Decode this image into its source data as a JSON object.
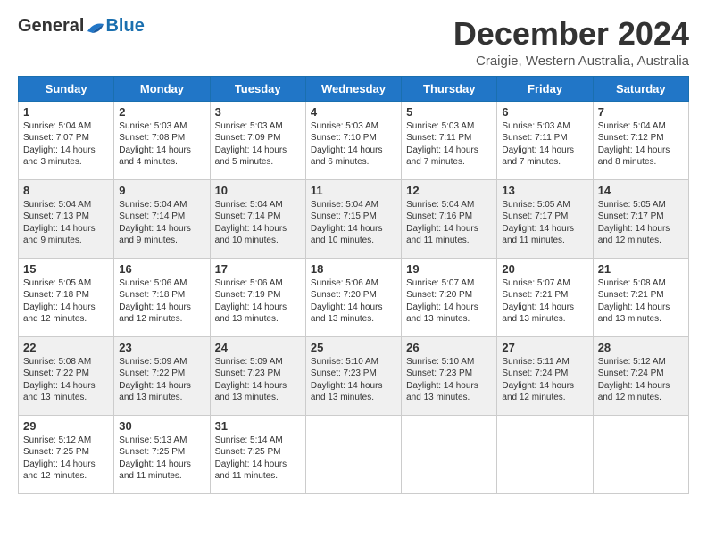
{
  "header": {
    "logo": {
      "general": "General",
      "blue": "Blue"
    },
    "title": "December 2024",
    "subtitle": "Craigie, Western Australia, Australia"
  },
  "calendar": {
    "days_of_week": [
      "Sunday",
      "Monday",
      "Tuesday",
      "Wednesday",
      "Thursday",
      "Friday",
      "Saturday"
    ],
    "weeks": [
      [
        {
          "day": "1",
          "sunrise": "5:04 AM",
          "sunset": "7:07 PM",
          "daylight": "14 hours and 3 minutes."
        },
        {
          "day": "2",
          "sunrise": "5:03 AM",
          "sunset": "7:08 PM",
          "daylight": "14 hours and 4 minutes."
        },
        {
          "day": "3",
          "sunrise": "5:03 AM",
          "sunset": "7:09 PM",
          "daylight": "14 hours and 5 minutes."
        },
        {
          "day": "4",
          "sunrise": "5:03 AM",
          "sunset": "7:10 PM",
          "daylight": "14 hours and 6 minutes."
        },
        {
          "day": "5",
          "sunrise": "5:03 AM",
          "sunset": "7:11 PM",
          "daylight": "14 hours and 7 minutes."
        },
        {
          "day": "6",
          "sunrise": "5:03 AM",
          "sunset": "7:11 PM",
          "daylight": "14 hours and 7 minutes."
        },
        {
          "day": "7",
          "sunrise": "5:04 AM",
          "sunset": "7:12 PM",
          "daylight": "14 hours and 8 minutes."
        }
      ],
      [
        {
          "day": "8",
          "sunrise": "5:04 AM",
          "sunset": "7:13 PM",
          "daylight": "14 hours and 9 minutes."
        },
        {
          "day": "9",
          "sunrise": "5:04 AM",
          "sunset": "7:14 PM",
          "daylight": "14 hours and 9 minutes."
        },
        {
          "day": "10",
          "sunrise": "5:04 AM",
          "sunset": "7:14 PM",
          "daylight": "14 hours and 10 minutes."
        },
        {
          "day": "11",
          "sunrise": "5:04 AM",
          "sunset": "7:15 PM",
          "daylight": "14 hours and 10 minutes."
        },
        {
          "day": "12",
          "sunrise": "5:04 AM",
          "sunset": "7:16 PM",
          "daylight": "14 hours and 11 minutes."
        },
        {
          "day": "13",
          "sunrise": "5:05 AM",
          "sunset": "7:17 PM",
          "daylight": "14 hours and 11 minutes."
        },
        {
          "day": "14",
          "sunrise": "5:05 AM",
          "sunset": "7:17 PM",
          "daylight": "14 hours and 12 minutes."
        }
      ],
      [
        {
          "day": "15",
          "sunrise": "5:05 AM",
          "sunset": "7:18 PM",
          "daylight": "14 hours and 12 minutes."
        },
        {
          "day": "16",
          "sunrise": "5:06 AM",
          "sunset": "7:18 PM",
          "daylight": "14 hours and 12 minutes."
        },
        {
          "day": "17",
          "sunrise": "5:06 AM",
          "sunset": "7:19 PM",
          "daylight": "14 hours and 13 minutes."
        },
        {
          "day": "18",
          "sunrise": "5:06 AM",
          "sunset": "7:20 PM",
          "daylight": "14 hours and 13 minutes."
        },
        {
          "day": "19",
          "sunrise": "5:07 AM",
          "sunset": "7:20 PM",
          "daylight": "14 hours and 13 minutes."
        },
        {
          "day": "20",
          "sunrise": "5:07 AM",
          "sunset": "7:21 PM",
          "daylight": "14 hours and 13 minutes."
        },
        {
          "day": "21",
          "sunrise": "5:08 AM",
          "sunset": "7:21 PM",
          "daylight": "14 hours and 13 minutes."
        }
      ],
      [
        {
          "day": "22",
          "sunrise": "5:08 AM",
          "sunset": "7:22 PM",
          "daylight": "14 hours and 13 minutes."
        },
        {
          "day": "23",
          "sunrise": "5:09 AM",
          "sunset": "7:22 PM",
          "daylight": "14 hours and 13 minutes."
        },
        {
          "day": "24",
          "sunrise": "5:09 AM",
          "sunset": "7:23 PM",
          "daylight": "14 hours and 13 minutes."
        },
        {
          "day": "25",
          "sunrise": "5:10 AM",
          "sunset": "7:23 PM",
          "daylight": "14 hours and 13 minutes."
        },
        {
          "day": "26",
          "sunrise": "5:10 AM",
          "sunset": "7:23 PM",
          "daylight": "14 hours and 13 minutes."
        },
        {
          "day": "27",
          "sunrise": "5:11 AM",
          "sunset": "7:24 PM",
          "daylight": "14 hours and 12 minutes."
        },
        {
          "day": "28",
          "sunrise": "5:12 AM",
          "sunset": "7:24 PM",
          "daylight": "14 hours and 12 minutes."
        }
      ],
      [
        {
          "day": "29",
          "sunrise": "5:12 AM",
          "sunset": "7:25 PM",
          "daylight": "14 hours and 12 minutes."
        },
        {
          "day": "30",
          "sunrise": "5:13 AM",
          "sunset": "7:25 PM",
          "daylight": "14 hours and 11 minutes."
        },
        {
          "day": "31",
          "sunrise": "5:14 AM",
          "sunset": "7:25 PM",
          "daylight": "14 hours and 11 minutes."
        },
        null,
        null,
        null,
        null
      ]
    ]
  }
}
